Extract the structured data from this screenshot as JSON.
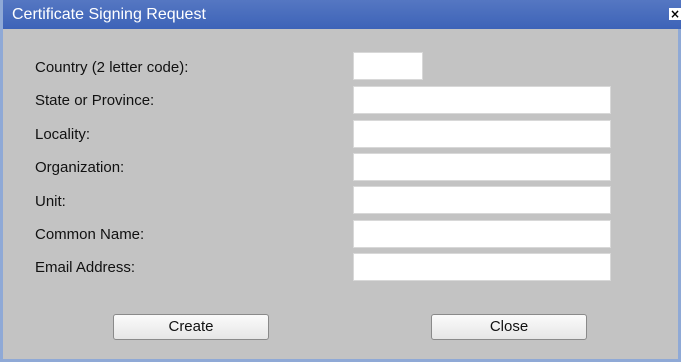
{
  "window": {
    "title": "Certificate Signing Request",
    "close_glyph": "×"
  },
  "form": {
    "fields": [
      {
        "label": "Country (2 letter code):",
        "value": "",
        "placeholder": ""
      },
      {
        "label": "State or Province:",
        "value": "",
        "placeholder": ""
      },
      {
        "label": "Locality:",
        "value": "",
        "placeholder": ""
      },
      {
        "label": "Organization:",
        "value": "",
        "placeholder": ""
      },
      {
        "label": "Unit:",
        "value": "",
        "placeholder": ""
      },
      {
        "label": "Common Name:",
        "value": "",
        "placeholder": ""
      },
      {
        "label": "Email Address:",
        "value": "",
        "placeholder": ""
      }
    ]
  },
  "buttons": {
    "create": "Create",
    "close": "Close"
  },
  "colors": {
    "titlebar": "#4a6fbf",
    "background": "#c3c3c3"
  }
}
